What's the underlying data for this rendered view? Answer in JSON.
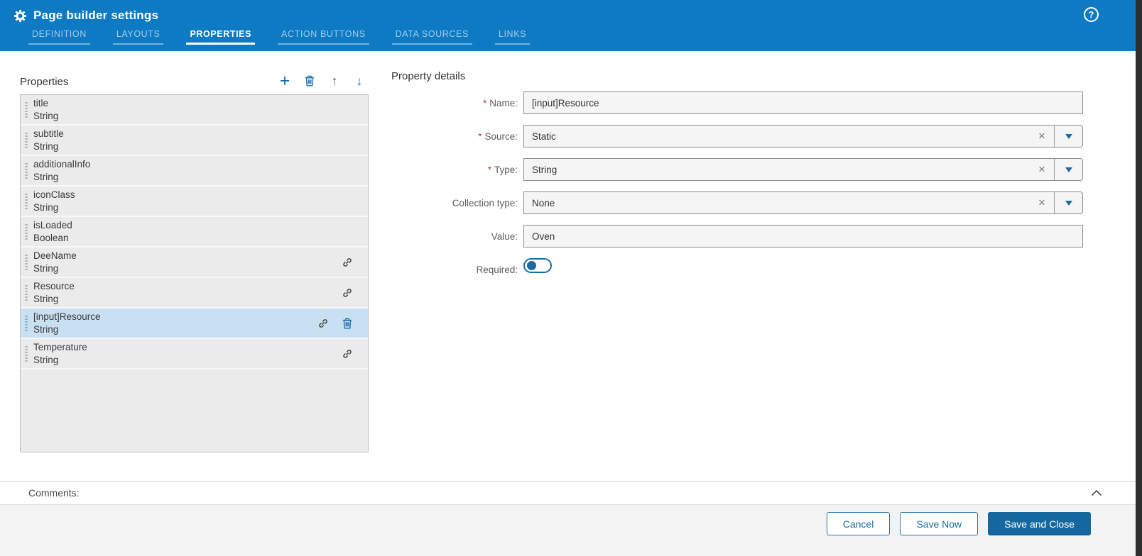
{
  "header": {
    "title": "Page builder settings",
    "help_icon": "?",
    "tabs": [
      {
        "label": "Definition",
        "active": false
      },
      {
        "label": "Layouts",
        "active": false
      },
      {
        "label": "Properties",
        "active": true
      },
      {
        "label": "Action buttons",
        "active": false
      },
      {
        "label": "Data sources",
        "active": false
      },
      {
        "label": "Links",
        "active": false
      }
    ]
  },
  "properties_panel": {
    "title": "Properties",
    "toolbar": [
      {
        "key": "add",
        "icon": "plus-icon",
        "glyph": "+"
      },
      {
        "key": "delete",
        "icon": "trash-icon"
      },
      {
        "key": "move-up",
        "icon": "arrow-up-icon",
        "glyph": "↑"
      },
      {
        "key": "move-down",
        "icon": "arrow-down-icon",
        "glyph": "↓"
      }
    ],
    "items": [
      {
        "name": "title",
        "type": "String",
        "linked": false,
        "selected": false
      },
      {
        "name": "subtitle",
        "type": "String",
        "linked": false,
        "selected": false
      },
      {
        "name": "additionalInfo",
        "type": "String",
        "linked": false,
        "selected": false
      },
      {
        "name": "iconClass",
        "type": "String",
        "linked": false,
        "selected": false
      },
      {
        "name": "isLoaded",
        "type": "Boolean",
        "linked": false,
        "selected": false
      },
      {
        "name": "DeeName",
        "type": "String",
        "linked": true,
        "selected": false
      },
      {
        "name": "Resource",
        "type": "String",
        "linked": true,
        "selected": false
      },
      {
        "name": "[input]Resource",
        "type": "String",
        "linked": true,
        "selected": true,
        "deletable": true
      },
      {
        "name": "Temperature",
        "type": "String",
        "linked": true,
        "selected": false
      }
    ]
  },
  "details_panel": {
    "title": "Property details",
    "fields": [
      {
        "key": "name",
        "label": "Name:",
        "required": true,
        "control": "text",
        "value": "[input]Resource"
      },
      {
        "key": "source",
        "label": "Source:",
        "required": true,
        "control": "combo",
        "value": "Static"
      },
      {
        "key": "type",
        "label": "Type:",
        "required": true,
        "control": "combo",
        "value": "String"
      },
      {
        "key": "collection-type",
        "label": "Collection type:",
        "required": false,
        "control": "combo",
        "value": "None"
      },
      {
        "key": "value",
        "label": "Value:",
        "required": false,
        "control": "text",
        "value": "Oven"
      },
      {
        "key": "required",
        "label": "Required:",
        "required": false,
        "control": "toggle",
        "value": false
      }
    ]
  },
  "comments": {
    "label": "Comments:"
  },
  "footer": {
    "buttons": [
      {
        "key": "cancel",
        "label": "Cancel",
        "style": "secondary"
      },
      {
        "key": "save-now",
        "label": "Save Now",
        "style": "secondary"
      },
      {
        "key": "save-and-close",
        "label": "Save and Close",
        "style": "primary"
      }
    ]
  },
  "colors": {
    "header_blue": "#0e7ac4",
    "accent_blue": "#1a6ca3",
    "primary_button": "#15689f",
    "selected_row": "#c9e0f2",
    "row_background": "#ebebeb",
    "asterisk_red": "#b23b34"
  }
}
